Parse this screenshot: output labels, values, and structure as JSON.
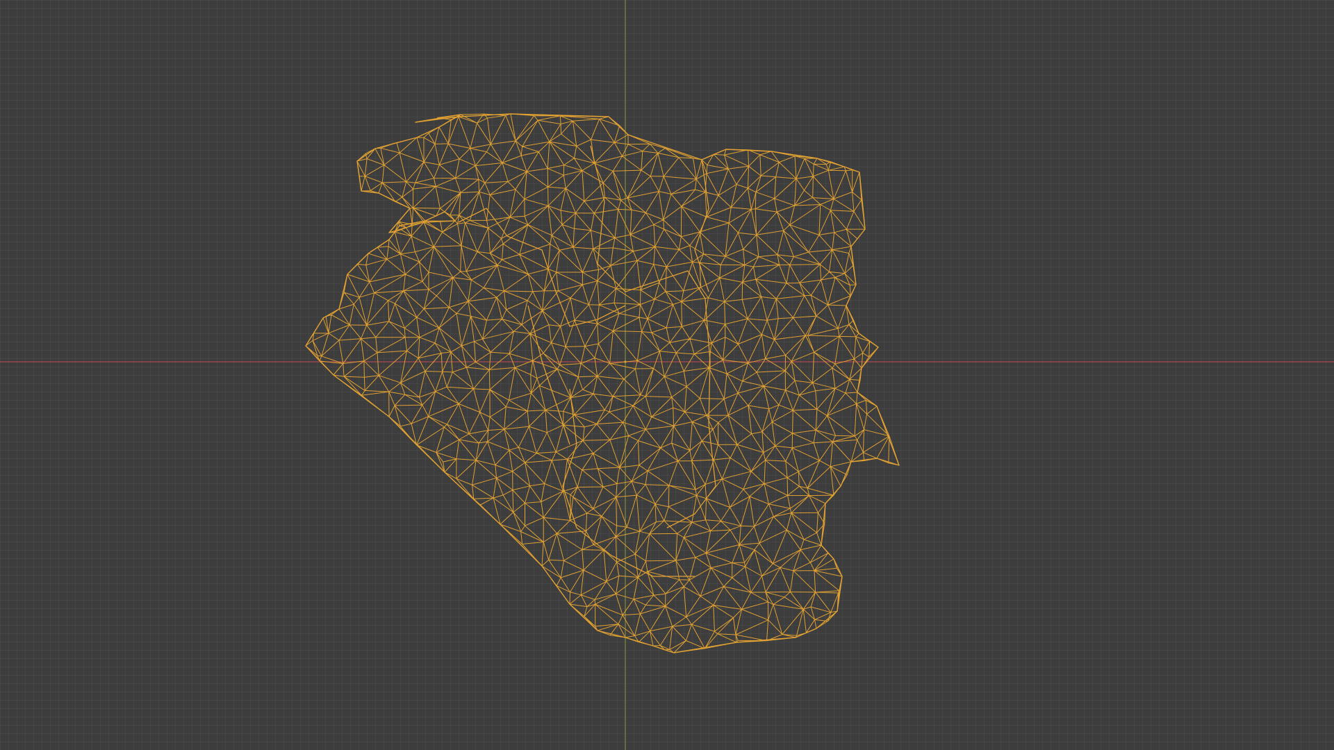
{
  "viewport": {
    "mode": "wireframe",
    "object": "rock-mesh"
  },
  "colors": {
    "background": "#3d3d3d",
    "grid": "#474747",
    "x_axis": "#a94a52",
    "y_axis": "#7a8a3a",
    "wireframe": "#e0a032"
  },
  "icons": {
    "origin": "origin-dot-icon"
  }
}
